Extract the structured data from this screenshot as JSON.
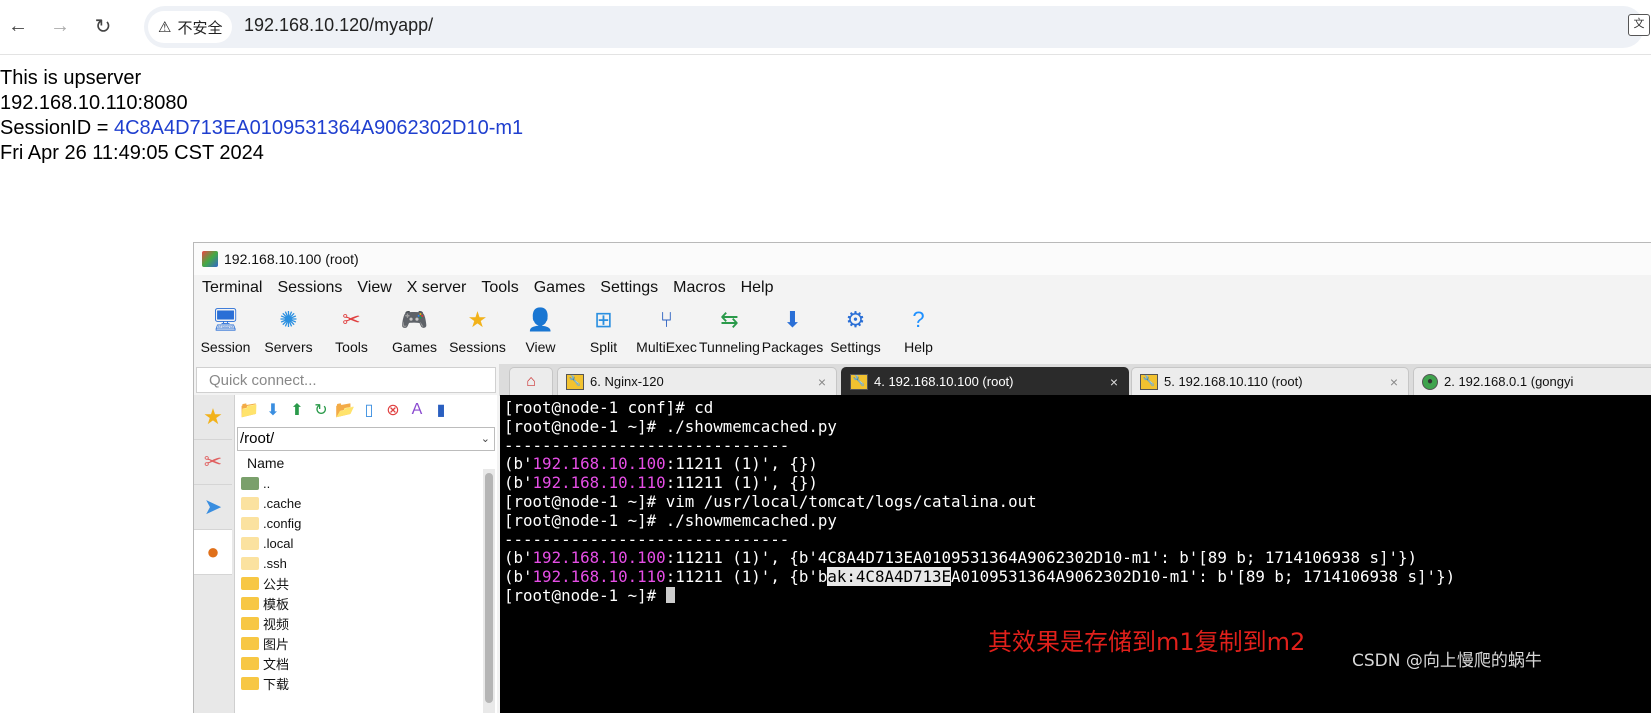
{
  "browser": {
    "security_label": "不安全",
    "url": "192.168.10.120/myapp/"
  },
  "page": {
    "line1": "This is upserver",
    "line2": "192.168.10.110:8080",
    "session_label": "SessionID = ",
    "session_id": "4C8A4D713EA0109531364A9062302D10-m1",
    "date": "Fri Apr 26 11:49:05 CST 2024"
  },
  "window": {
    "title": "192.168.10.100 (root)",
    "menu": [
      "Terminal",
      "Sessions",
      "View",
      "X server",
      "Tools",
      "Games",
      "Settings",
      "Macros",
      "Help"
    ],
    "toolbar": [
      "Session",
      "Servers",
      "Tools",
      "Games",
      "Sessions",
      "View",
      "Split",
      "MultiExec",
      "Tunneling",
      "Packages",
      "Settings",
      "Help"
    ],
    "quick_connect_placeholder": "Quick connect...",
    "tabs": [
      "6. Nginx-120",
      "4. 192.168.10.100 (root)",
      "5. 192.168.10.110 (root)",
      "2. 192.168.0.1 (gongyi"
    ]
  },
  "files": {
    "path": "/root/",
    "header": "Name",
    "items": [
      "..",
      ".cache",
      ".config",
      ".local",
      ".ssh",
      "公共",
      "模板",
      "视频",
      "图片",
      "文档",
      "下载"
    ]
  },
  "terminal": {
    "prompt_conf": "[root@node-1 conf]# ",
    "cmd_cd": "cd",
    "prompt": "[root@node-1 ~]# ",
    "cmd_show": "./showmemcached.py",
    "divider": "------------------------------",
    "b_prefix": "(b'",
    "ip1": "192.168.10.100",
    "ip2": "192.168.10.110",
    "port_suffix_empty": ":11211 (1)', {})",
    "port_suffix": ":11211 (1)', ",
    "cmd_vim": "vim /usr/local/tomcat/logs/catalina.out",
    "entry1": "{b'4C8A4D713EA0109531364A9062302D10-m1': b'[89 b; 1714106938 s]'})",
    "entry2_pre": "{b'b",
    "entry2_sel": "ak:4C8A4D713E",
    "entry2_post": "A0109531364A9062302D10-m1': b'[89 b; 1714106938 s]'})"
  },
  "annotation": "其效果是存储到m1复制到m2",
  "watermark": "CSDN @向上慢爬的蜗牛"
}
